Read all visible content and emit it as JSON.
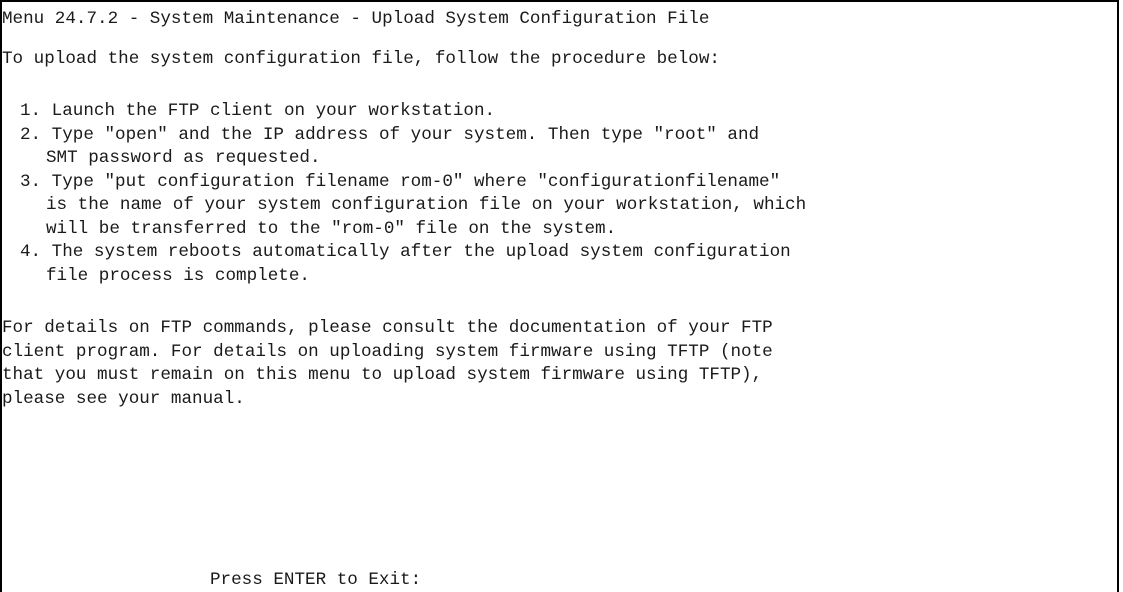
{
  "screen": {
    "title": "Menu 24.7.2 - System Maintenance - Upload System Configuration File",
    "intro": "To upload the system configuration file, follow the procedure below:",
    "steps": [
      [
        "1. Launch the FTP client on your workstation."
      ],
      [
        "2. Type \"open\" and the IP address of your system. Then type \"root\" and",
        "SMT password as requested."
      ],
      [
        "3. Type \"put configuration filename rom-0\" where \"configurationfilename\"",
        "is the name of your system configuration file on your workstation, which",
        "will be transferred to the \"rom-0\" file on the system."
      ],
      [
        "4. The system reboots automatically after the upload system configuration",
        "file process is complete."
      ]
    ],
    "details": [
      "For details on FTP commands, please consult the documentation of your FTP",
      "client program. For details on uploading system firmware using TFTP (note",
      "that you must remain on this menu to upload system firmware using TFTP),",
      "please see your manual."
    ],
    "exit_prompt": "Press ENTER to Exit:"
  }
}
